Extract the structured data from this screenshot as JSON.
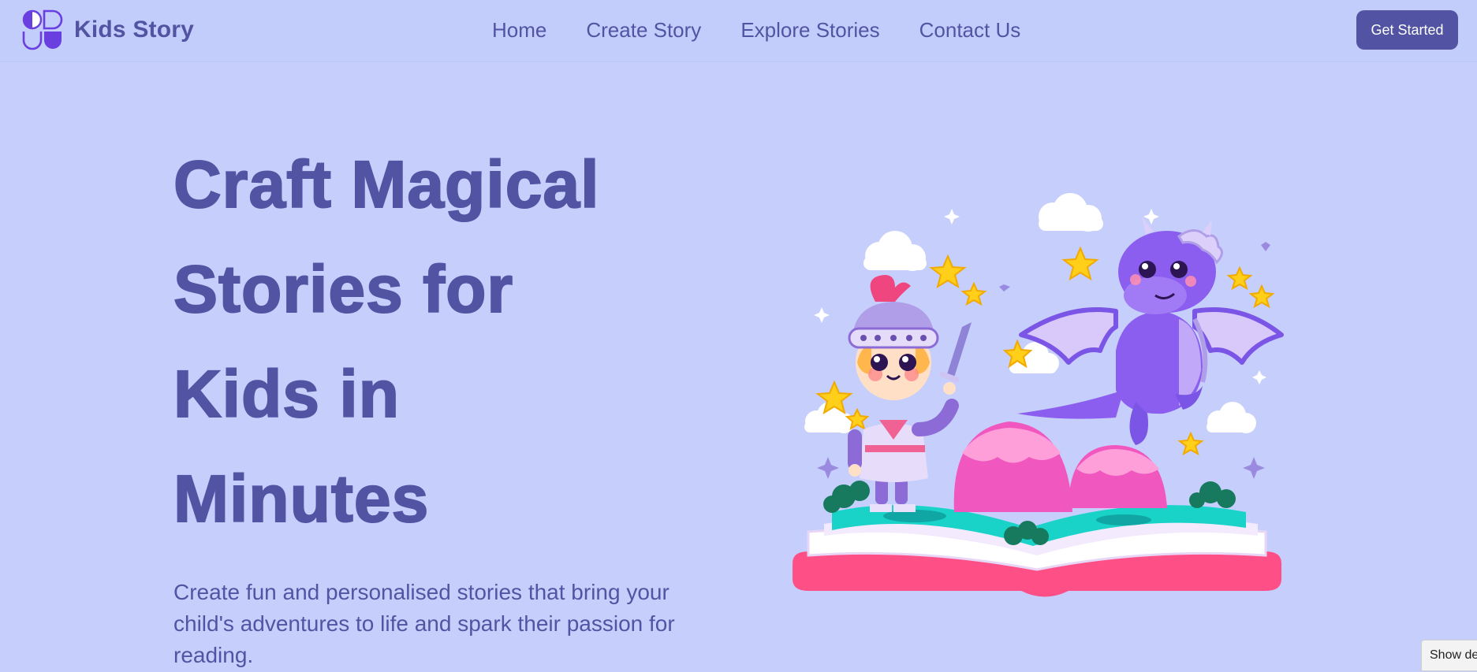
{
  "brand": {
    "name": "Kids Story",
    "logo_icon": "kids-story-logo-icon"
  },
  "nav": {
    "items": [
      {
        "label": "Home"
      },
      {
        "label": "Create Story"
      },
      {
        "label": "Explore Stories"
      },
      {
        "label": "Contact Us"
      }
    ],
    "cta_label": "Get Started"
  },
  "hero": {
    "title_lines": [
      "Craft Magical",
      "Stories for",
      "Kids in",
      "Minutes"
    ],
    "subtitle_lines": [
      "Create fun and personalised stories that bring your",
      "child's adventures to life and spark their passion for",
      "reading."
    ],
    "illustration_icon": "knight-dragon-storybook-illustration"
  },
  "corner_tab": {
    "label": "Show des"
  },
  "colors": {
    "background": "#c6cffc",
    "brand": "#5254a3",
    "button_text": "#ffffff"
  }
}
